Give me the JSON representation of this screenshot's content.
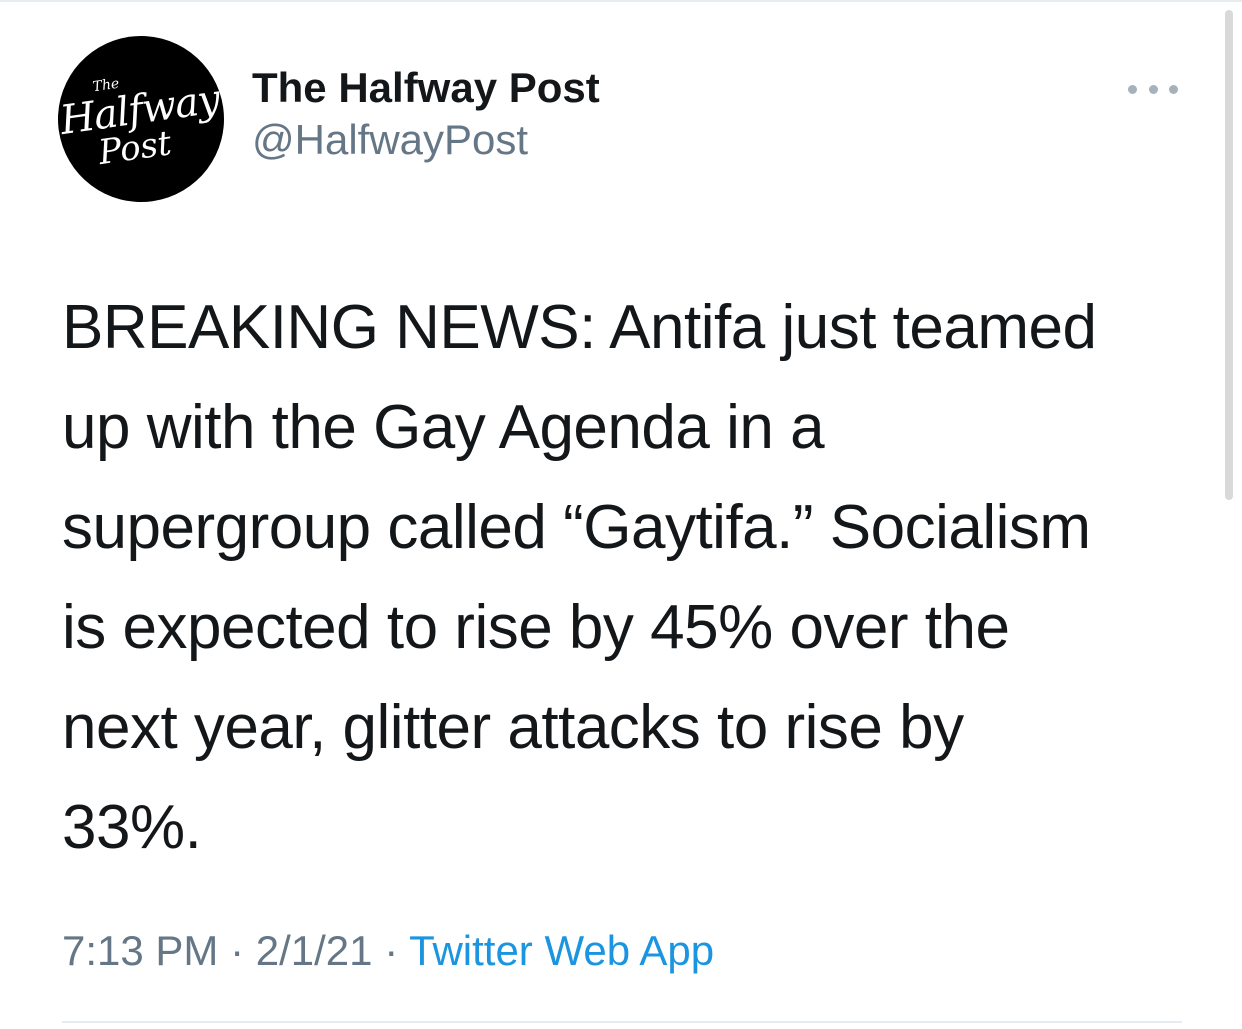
{
  "avatar": {
    "line1": "The",
    "line2": "Halfway",
    "line3": "Post"
  },
  "author": {
    "display_name": "The Halfway Post",
    "handle": "@HalfwayPost"
  },
  "tweet": {
    "lines": [
      "BREAKING NEWS: Antifa just teamed",
      "up with the Gay Agenda in a",
      "supergroup called “Gaytifa.” Socialism",
      "is expected to rise by 45% over the",
      "next year, glitter attacks to rise by",
      "33%."
    ]
  },
  "meta": {
    "time": "7:13 PM",
    "sep1": " · ",
    "date": "2/1/21",
    "sep2": " · ",
    "source": "Twitter Web App"
  },
  "icons": {
    "more": "more-horizontal-icon"
  },
  "colors": {
    "text": "#14171a",
    "secondary": "#657786",
    "link": "#1b95e0"
  }
}
